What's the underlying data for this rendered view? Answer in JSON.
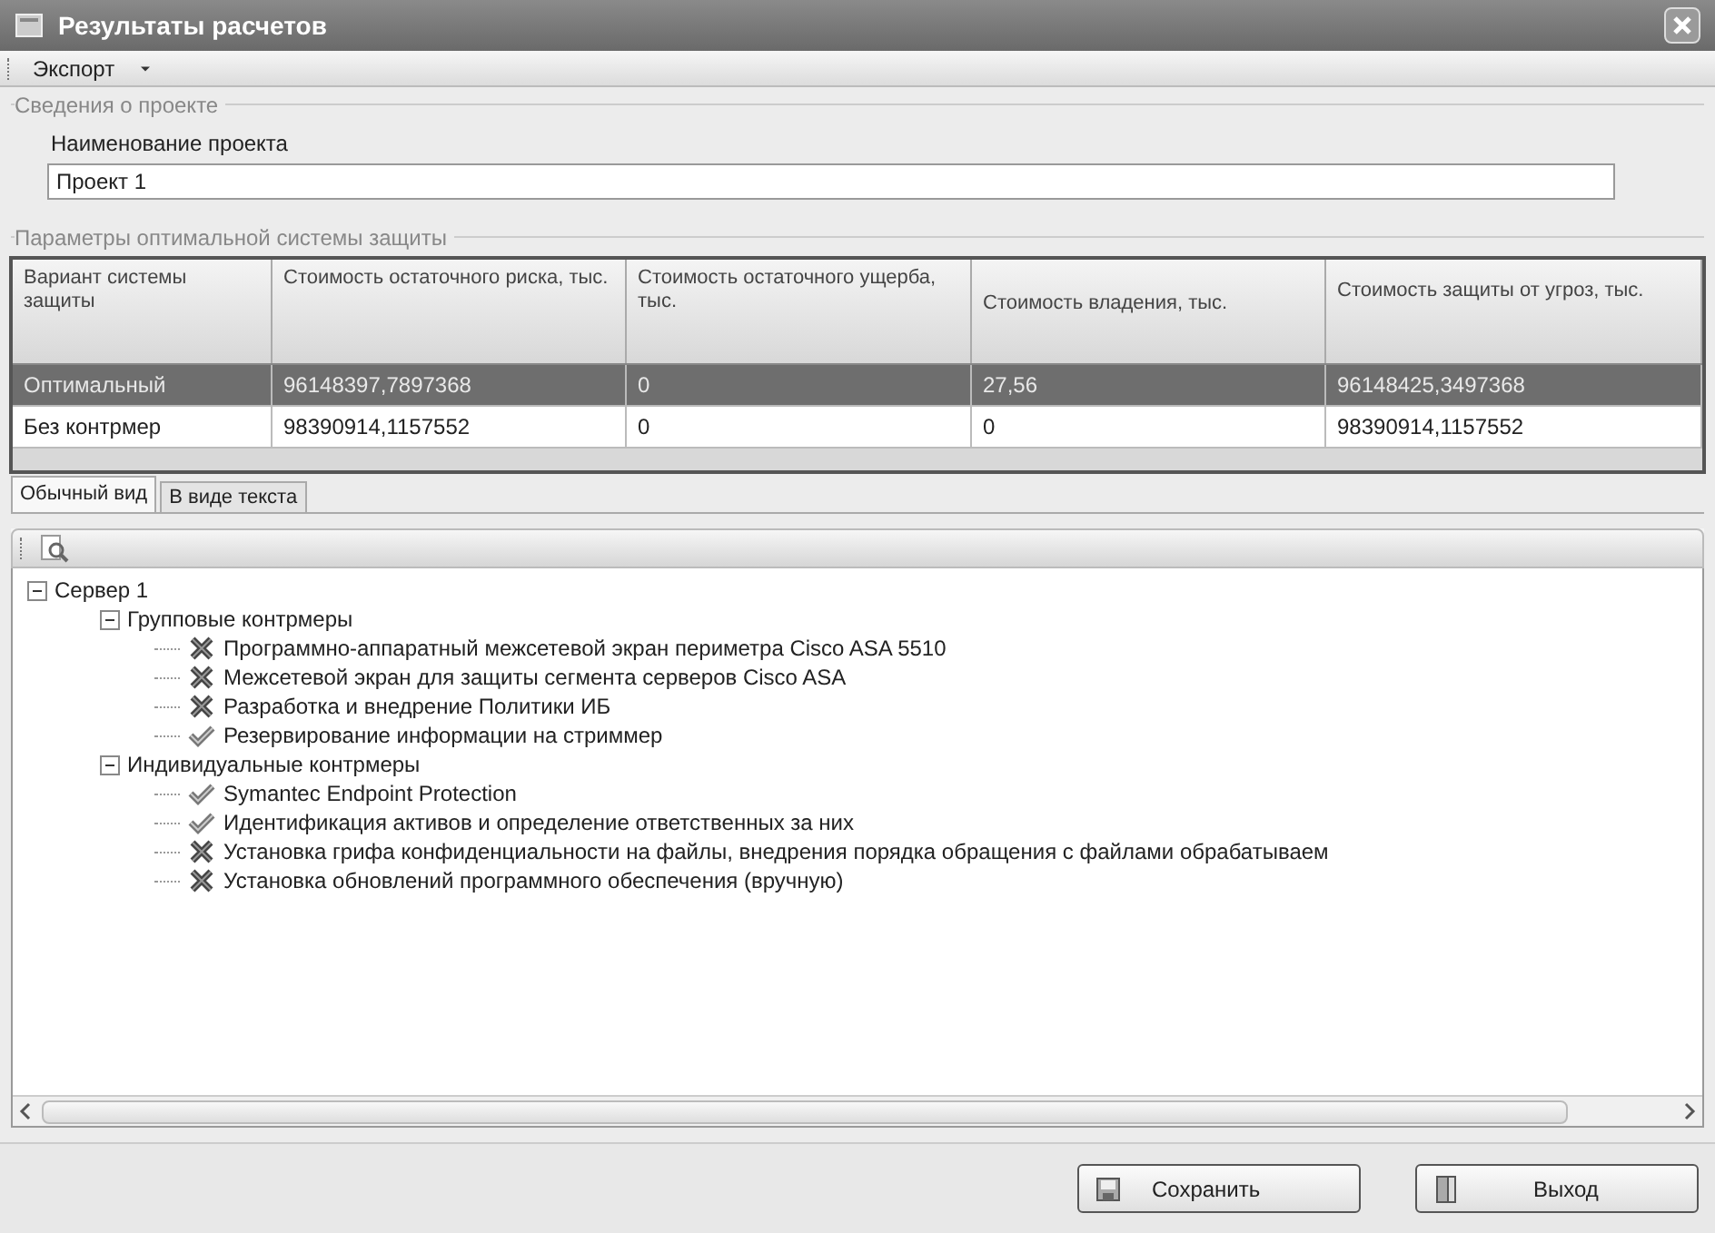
{
  "window": {
    "title": "Результаты расчетов"
  },
  "toolbar": {
    "menu": "Экспорт"
  },
  "project_group": {
    "title": "Сведения о проекте",
    "label": "Наименование проекта",
    "value": "Проект 1"
  },
  "params_group": {
    "title": "Параметры оптимальной системы защиты"
  },
  "table": {
    "columns": [
      "Вариант системы защиты",
      "Стоимость остаточного риска, тыс.",
      "Стоимость остаточного ущерба, тыс.",
      "Стоимость владения, тыс.",
      "Стоимость защиты от угроз, тыс."
    ],
    "rows": [
      {
        "selected": true,
        "cells": [
          "Оптимальный",
          "96148397,7897368",
          "0",
          "27,56",
          "96148425,3497368"
        ]
      },
      {
        "selected": false,
        "cells": [
          "Без контрмер",
          "98390914,1157552",
          "0",
          "0",
          "98390914,1157552"
        ]
      }
    ]
  },
  "tabs": [
    {
      "label": "Обычный вид",
      "selected": true
    },
    {
      "label": "В виде текста",
      "selected": false
    }
  ],
  "tree": [
    {
      "label": "Сервер 1",
      "expanded": true,
      "children": [
        {
          "label": "Групповые контрмеры",
          "expanded": true,
          "children": [
            {
              "label": "Программно-аппаратный межсетевой экран периметра Cisco ASA 5510",
              "kind": "cross"
            },
            {
              "label": "Межсетевой экран для защиты сегмента серверов Cisco ASA",
              "kind": "cross"
            },
            {
              "label": "Разработка и внедрение Политики ИБ",
              "kind": "cross"
            },
            {
              "label": "Резервирование информации на стриммер",
              "kind": "check"
            }
          ]
        },
        {
          "label": "Индивидуальные контрмеры",
          "expanded": true,
          "children": [
            {
              "label": "Symantec Endpoint Protection",
              "kind": "check"
            },
            {
              "label": "Идентификация активов и определение ответственных за них",
              "kind": "check"
            },
            {
              "label": "Установка грифа конфиденциальности на файлы, внедрения порядка обращения с файлами обрабатываем",
              "kind": "cross"
            },
            {
              "label": "Установка обновлений программного обеспечения (вручную)",
              "kind": "cross"
            }
          ]
        }
      ]
    }
  ],
  "buttons": [
    {
      "label": "Сохранить",
      "kind": "save"
    },
    {
      "label": "Выход",
      "kind": "exit"
    }
  ]
}
